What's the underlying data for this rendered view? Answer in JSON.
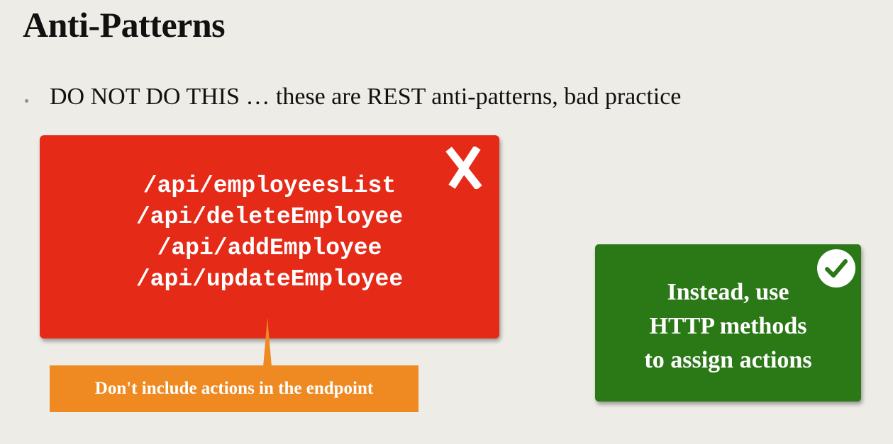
{
  "slide": {
    "title": "Anti-Patterns",
    "bullet": "DO NOT DO THIS … these are REST anti-patterns, bad practice"
  },
  "bad_box": {
    "icon": "x-mark-icon",
    "endpoints": [
      "/api/employeesList",
      "/api/deleteEmployee",
      "/api/addEmployee",
      "/api/updateEmployee"
    ],
    "color": "#e52a17"
  },
  "callout": {
    "text": "Don't include actions in the endpoint",
    "color": "#ef8a22"
  },
  "good_box": {
    "icon": "check-circle-icon",
    "lines": [
      "Instead, use",
      "HTTP methods",
      "to assign actions"
    ],
    "color": "#2b7817"
  }
}
